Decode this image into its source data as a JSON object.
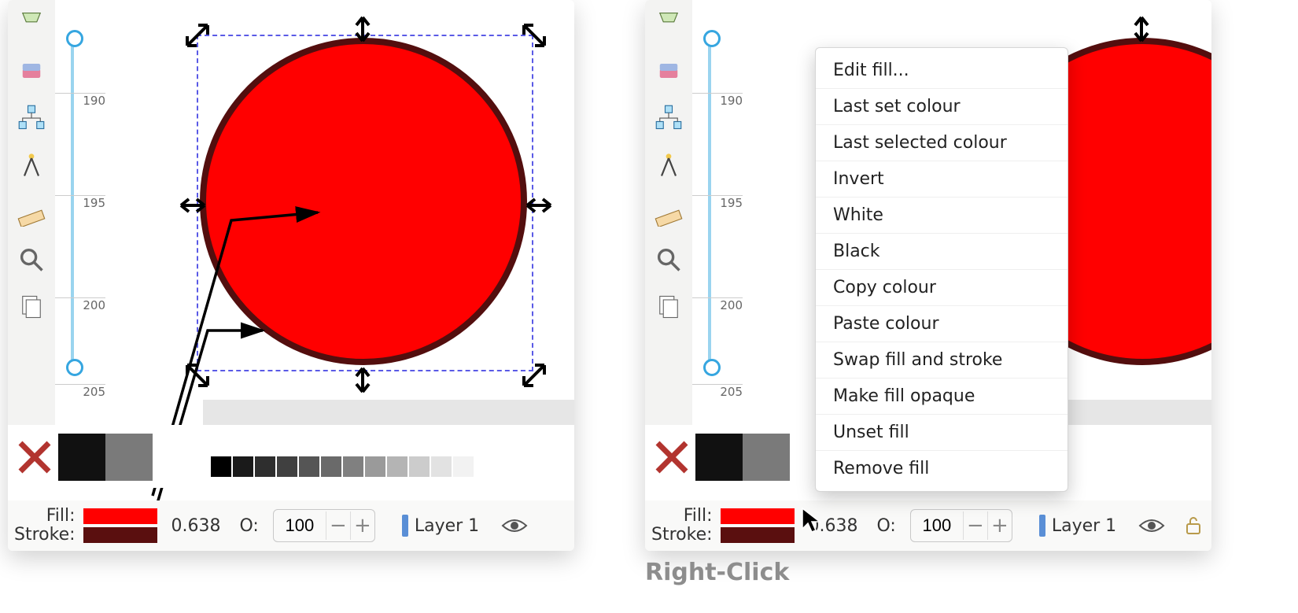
{
  "ruler_ticks": [
    "190",
    "195",
    "200",
    "205"
  ],
  "status": {
    "fill_label": "Fill:",
    "stroke_label": "Stroke:",
    "fill_color": "#ff0000",
    "stroke_color": "#5a0f0f",
    "stroke_width": "0.638",
    "opacity_label": "O:",
    "opacity_value": "100",
    "layer_label": "Layer 1"
  },
  "palette": {
    "big": [
      "#111111",
      "#7a7a7a"
    ],
    "mini": [
      "#000000",
      "#1a1a1a",
      "#2e2e2e",
      "#404040",
      "#555555",
      "#6a6a6a",
      "#808080",
      "#9a9a9a",
      "#b4b4b4",
      "#cccccc",
      "#e2e2e2",
      "#f2f2f2"
    ]
  },
  "context_menu": {
    "items": [
      "Edit fill...",
      "Last set colour",
      "Last selected colour",
      "Invert",
      "White",
      "Black",
      "Copy colour",
      "Paste colour",
      "Swap fill and stroke",
      "Make fill opaque",
      "Unset fill",
      "Remove fill"
    ]
  },
  "caption": "Right-Click"
}
